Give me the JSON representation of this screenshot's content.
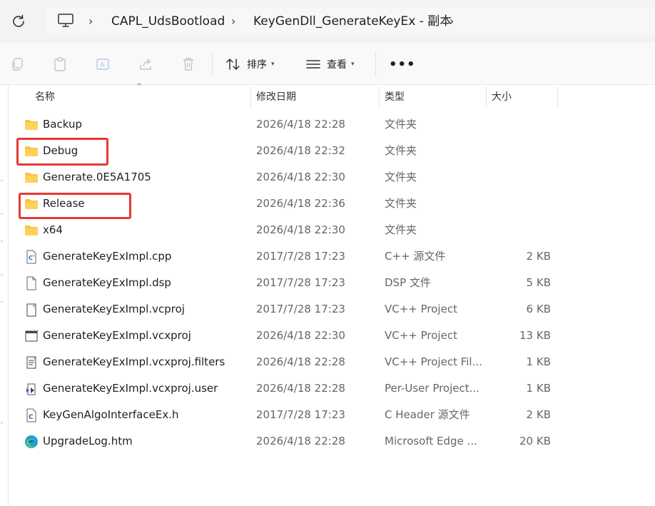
{
  "breadcrumbs": [
    "CAPL_UdsBootload",
    "KeyGenDll_GenerateKeyEx - 副本"
  ],
  "toolbar": {
    "sort_label": "排序",
    "view_label": "查看",
    "more_label": "•••"
  },
  "columns": {
    "name": "名称",
    "date": "修改日期",
    "type": "类型",
    "size": "大小"
  },
  "files": [
    {
      "name": "Backup",
      "date": "2026/4/18 22:28",
      "type": "文件夹",
      "size": "",
      "icon": "folder-icon"
    },
    {
      "name": "Debug",
      "date": "2026/4/18 22:32",
      "type": "文件夹",
      "size": "",
      "icon": "folder-icon"
    },
    {
      "name": "Generate.0E5A1705",
      "date": "2026/4/18 22:30",
      "type": "文件夹",
      "size": "",
      "icon": "folder-icon"
    },
    {
      "name": "Release",
      "date": "2026/4/18 22:36",
      "type": "文件夹",
      "size": "",
      "icon": "folder-icon"
    },
    {
      "name": "x64",
      "date": "2026/4/18 22:30",
      "type": "文件夹",
      "size": "",
      "icon": "folder-icon"
    },
    {
      "name": "GenerateKeyExImpl.cpp",
      "date": "2017/7/28 17:23",
      "type": "C++ 源文件",
      "size": "2 KB",
      "icon": "cpp-file-icon"
    },
    {
      "name": "GenerateKeyExImpl.dsp",
      "date": "2017/7/28 17:23",
      "type": "DSP 文件",
      "size": "5 KB",
      "icon": "blank-file-icon"
    },
    {
      "name": "GenerateKeyExImpl.vcproj",
      "date": "2017/7/28 17:23",
      "type": "VC++ Project",
      "size": "6 KB",
      "icon": "vcproj-file-icon"
    },
    {
      "name": "GenerateKeyExImpl.vcxproj",
      "date": "2026/4/18 22:30",
      "type": "VC++ Project",
      "size": "13 KB",
      "icon": "vcxproj-file-icon"
    },
    {
      "name": "GenerateKeyExImpl.vcxproj.filters",
      "date": "2026/4/18 22:28",
      "type": "VC++ Project Fil...",
      "size": "1 KB",
      "icon": "filters-file-icon"
    },
    {
      "name": "GenerateKeyExImpl.vcxproj.user",
      "date": "2026/4/18 22:28",
      "type": "Per-User Project...",
      "size": "1 KB",
      "icon": "vs-user-file-icon"
    },
    {
      "name": "KeyGenAlgoInterfaceEx.h",
      "date": "2017/7/28 17:23",
      "type": "C Header 源文件",
      "size": "2 KB",
      "icon": "header-file-icon"
    },
    {
      "name": "UpgradeLog.htm",
      "date": "2026/4/18 22:28",
      "type": "Microsoft Edge ...",
      "size": "20 KB",
      "icon": "edge-html-icon"
    }
  ],
  "colors": {
    "folder": "#f8c543",
    "highlight": "#e53935",
    "accent": "#0067c0"
  }
}
